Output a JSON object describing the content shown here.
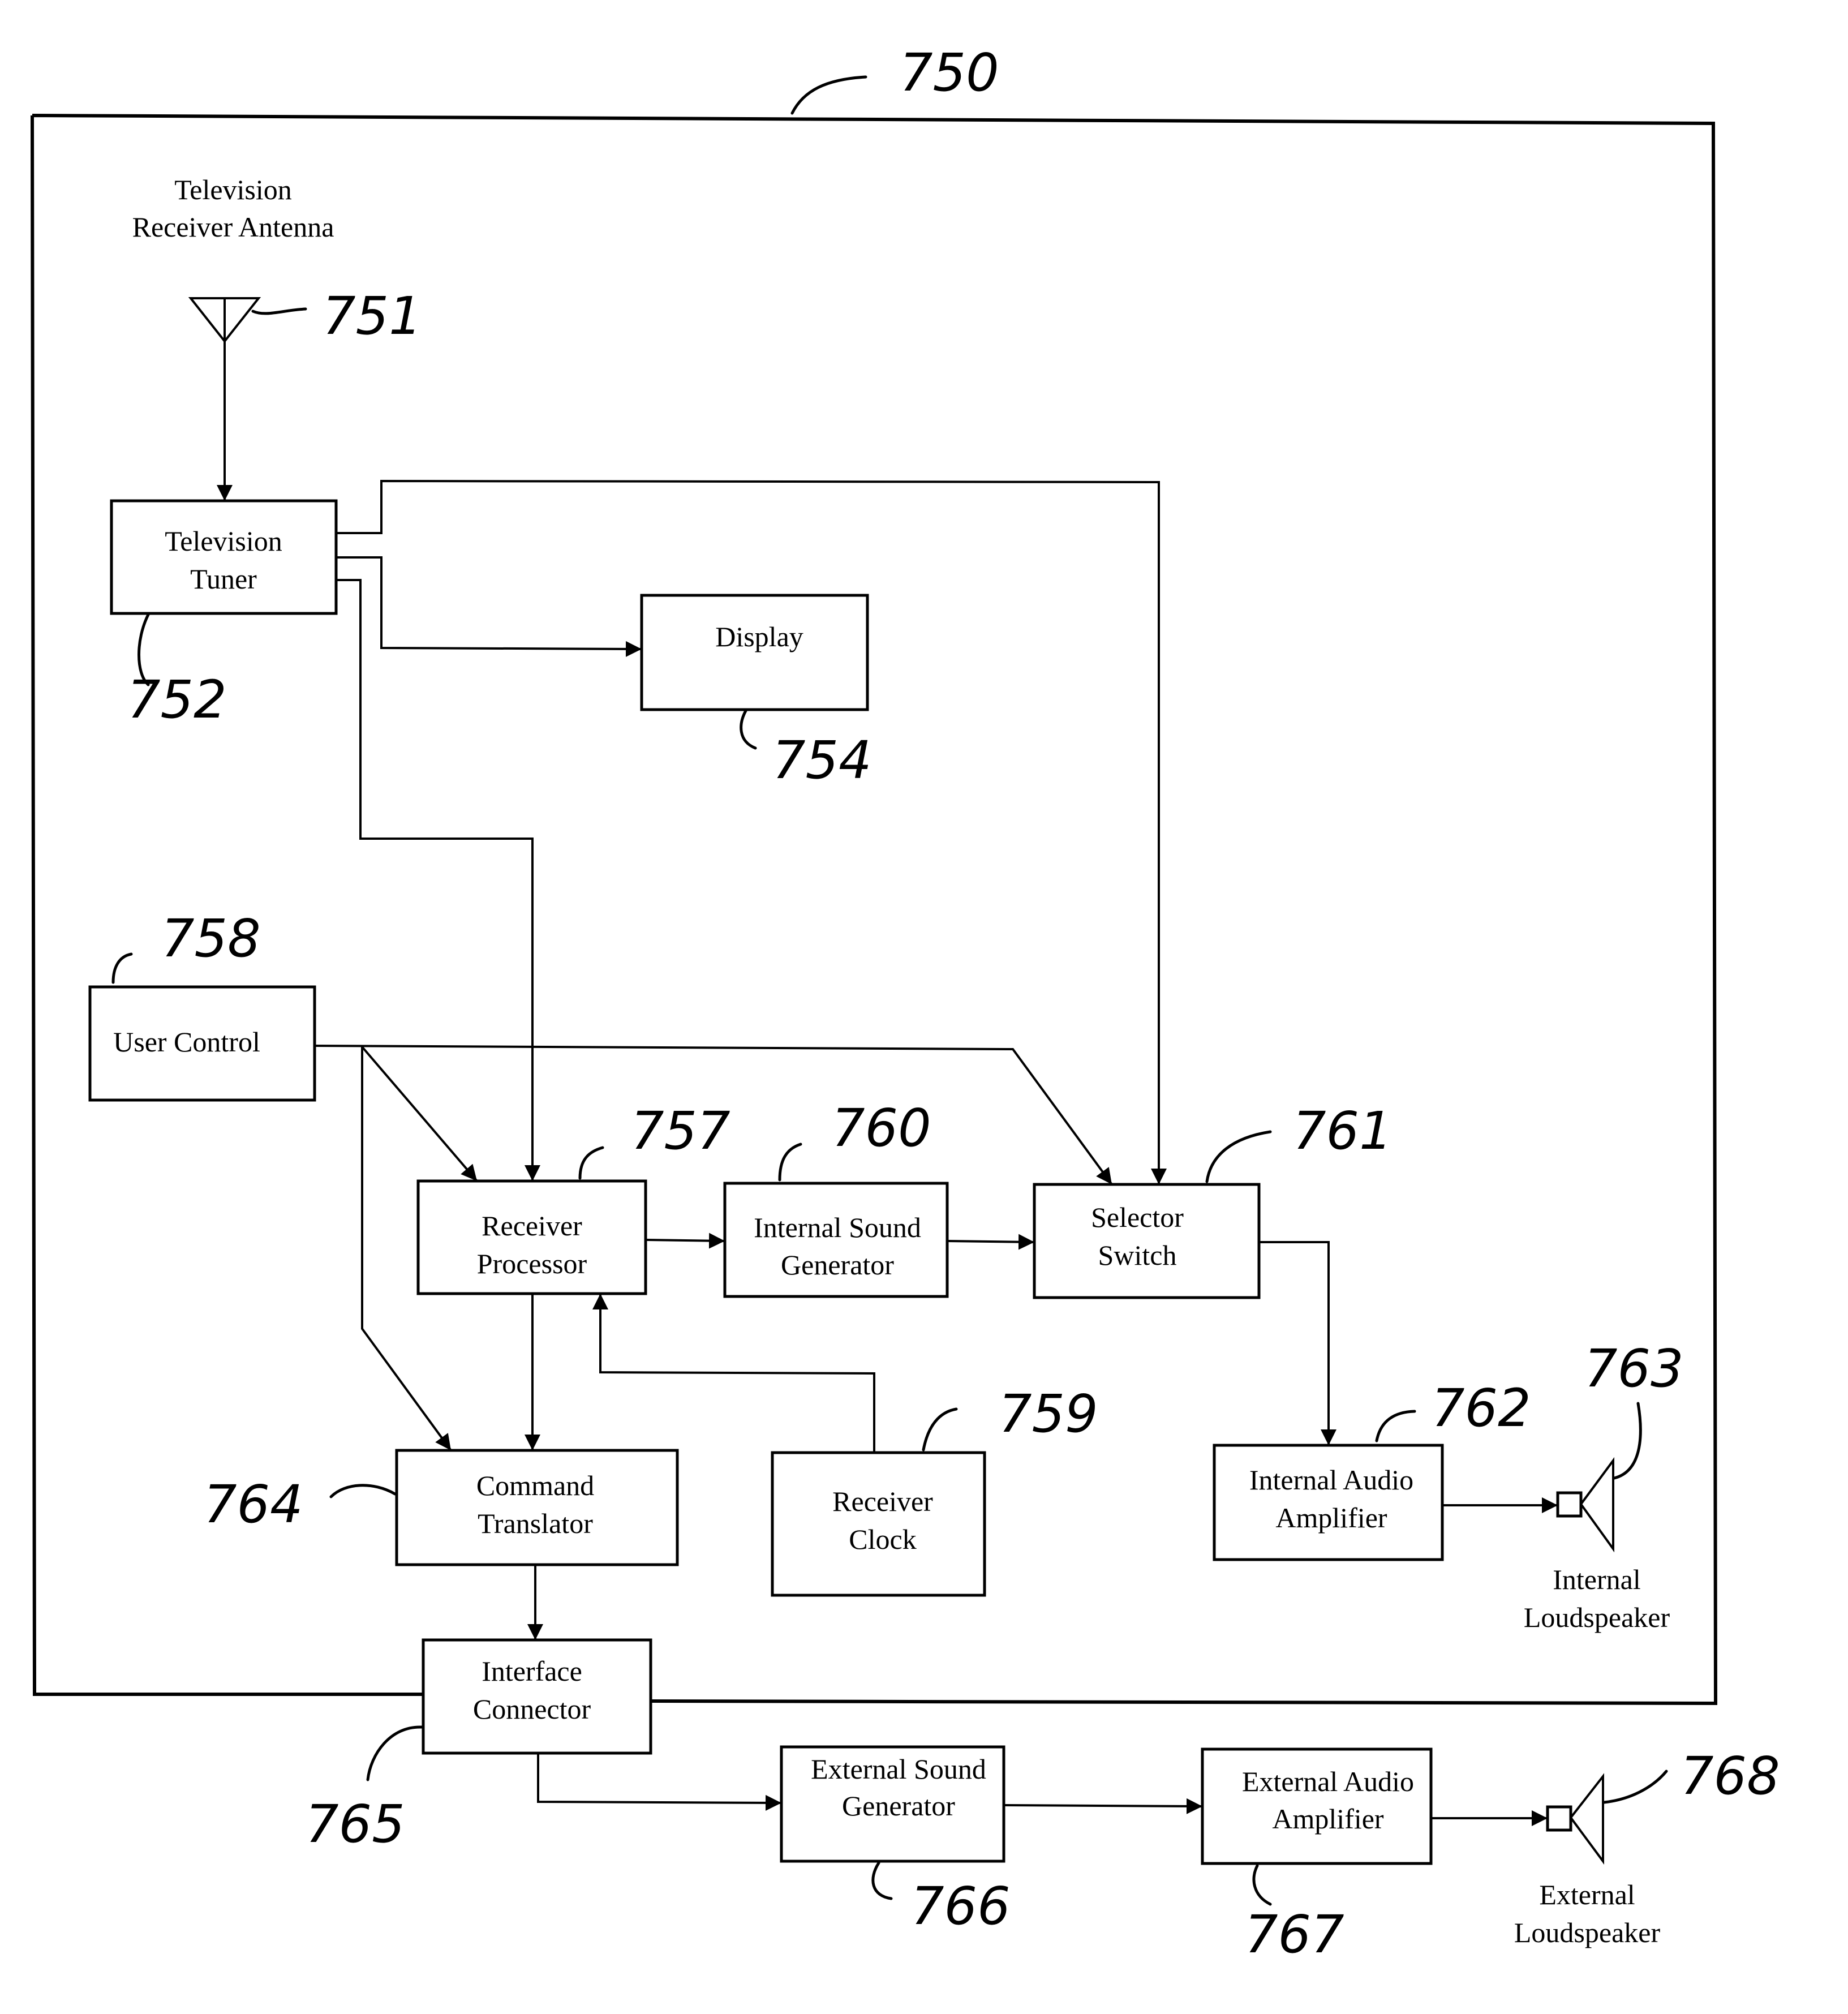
{
  "figure": {
    "system_ref": "750",
    "colors": {
      "ink": "#000000",
      "paper": "#ffffff"
    }
  },
  "components": {
    "antenna": {
      "ref": "751",
      "label_lines": [
        "Television",
        "Receiver Antenna"
      ],
      "icon": "antenna-icon"
    },
    "tuner": {
      "ref": "752",
      "label_lines": [
        "Television",
        "Tuner"
      ]
    },
    "display": {
      "ref": "754",
      "label_lines": [
        "Display"
      ]
    },
    "receiver_processor": {
      "ref": "757",
      "label_lines": [
        "Receiver",
        "Processor"
      ]
    },
    "user_control": {
      "ref": "758",
      "label_lines": [
        "User Control"
      ]
    },
    "receiver_clock": {
      "ref": "759",
      "label_lines": [
        "Receiver",
        "Clock"
      ]
    },
    "internal_sound_generator": {
      "ref": "760",
      "label_lines": [
        "Internal Sound",
        "Generator"
      ]
    },
    "selector_switch": {
      "ref": "761",
      "label_lines": [
        "Selector",
        "Switch"
      ]
    },
    "internal_audio_amplifier": {
      "ref": "762",
      "label_lines": [
        "Internal Audio",
        "Amplifier"
      ]
    },
    "internal_loudspeaker": {
      "ref": "763",
      "label_lines": [
        "Internal",
        "Loudspeaker"
      ],
      "icon": "loudspeaker-icon"
    },
    "command_translator": {
      "ref": "764",
      "label_lines": [
        "Command",
        "Translator"
      ]
    },
    "interface_connector": {
      "ref": "765",
      "label_lines": [
        "Interface",
        "Connector"
      ]
    },
    "external_sound_generator": {
      "ref": "766",
      "label_lines": [
        "External Sound",
        "Generator"
      ]
    },
    "external_audio_amplifier": {
      "ref": "767",
      "label_lines": [
        "External Audio",
        "Amplifier"
      ]
    },
    "external_loudspeaker": {
      "ref": "768",
      "label_lines": [
        "External",
        "Loudspeaker"
      ],
      "icon": "loudspeaker-icon"
    }
  },
  "connections": [
    {
      "from": "antenna",
      "to": "tuner"
    },
    {
      "from": "tuner",
      "to": "selector_switch"
    },
    {
      "from": "tuner",
      "to": "display"
    },
    {
      "from": "tuner",
      "to": "receiver_processor"
    },
    {
      "from": "user_control",
      "to": "receiver_processor"
    },
    {
      "from": "user_control",
      "to": "selector_switch"
    },
    {
      "from": "user_control",
      "to": "command_translator"
    },
    {
      "from": "receiver_processor",
      "to": "internal_sound_generator"
    },
    {
      "from": "receiver_processor",
      "to": "command_translator"
    },
    {
      "from": "receiver_clock",
      "to": "receiver_processor"
    },
    {
      "from": "internal_sound_generator",
      "to": "selector_switch"
    },
    {
      "from": "selector_switch",
      "to": "internal_audio_amplifier"
    },
    {
      "from": "internal_audio_amplifier",
      "to": "internal_loudspeaker"
    },
    {
      "from": "command_translator",
      "to": "interface_connector"
    },
    {
      "from": "interface_connector",
      "to": "external_sound_generator"
    },
    {
      "from": "external_sound_generator",
      "to": "external_audio_amplifier"
    },
    {
      "from": "external_audio_amplifier",
      "to": "external_loudspeaker"
    }
  ]
}
